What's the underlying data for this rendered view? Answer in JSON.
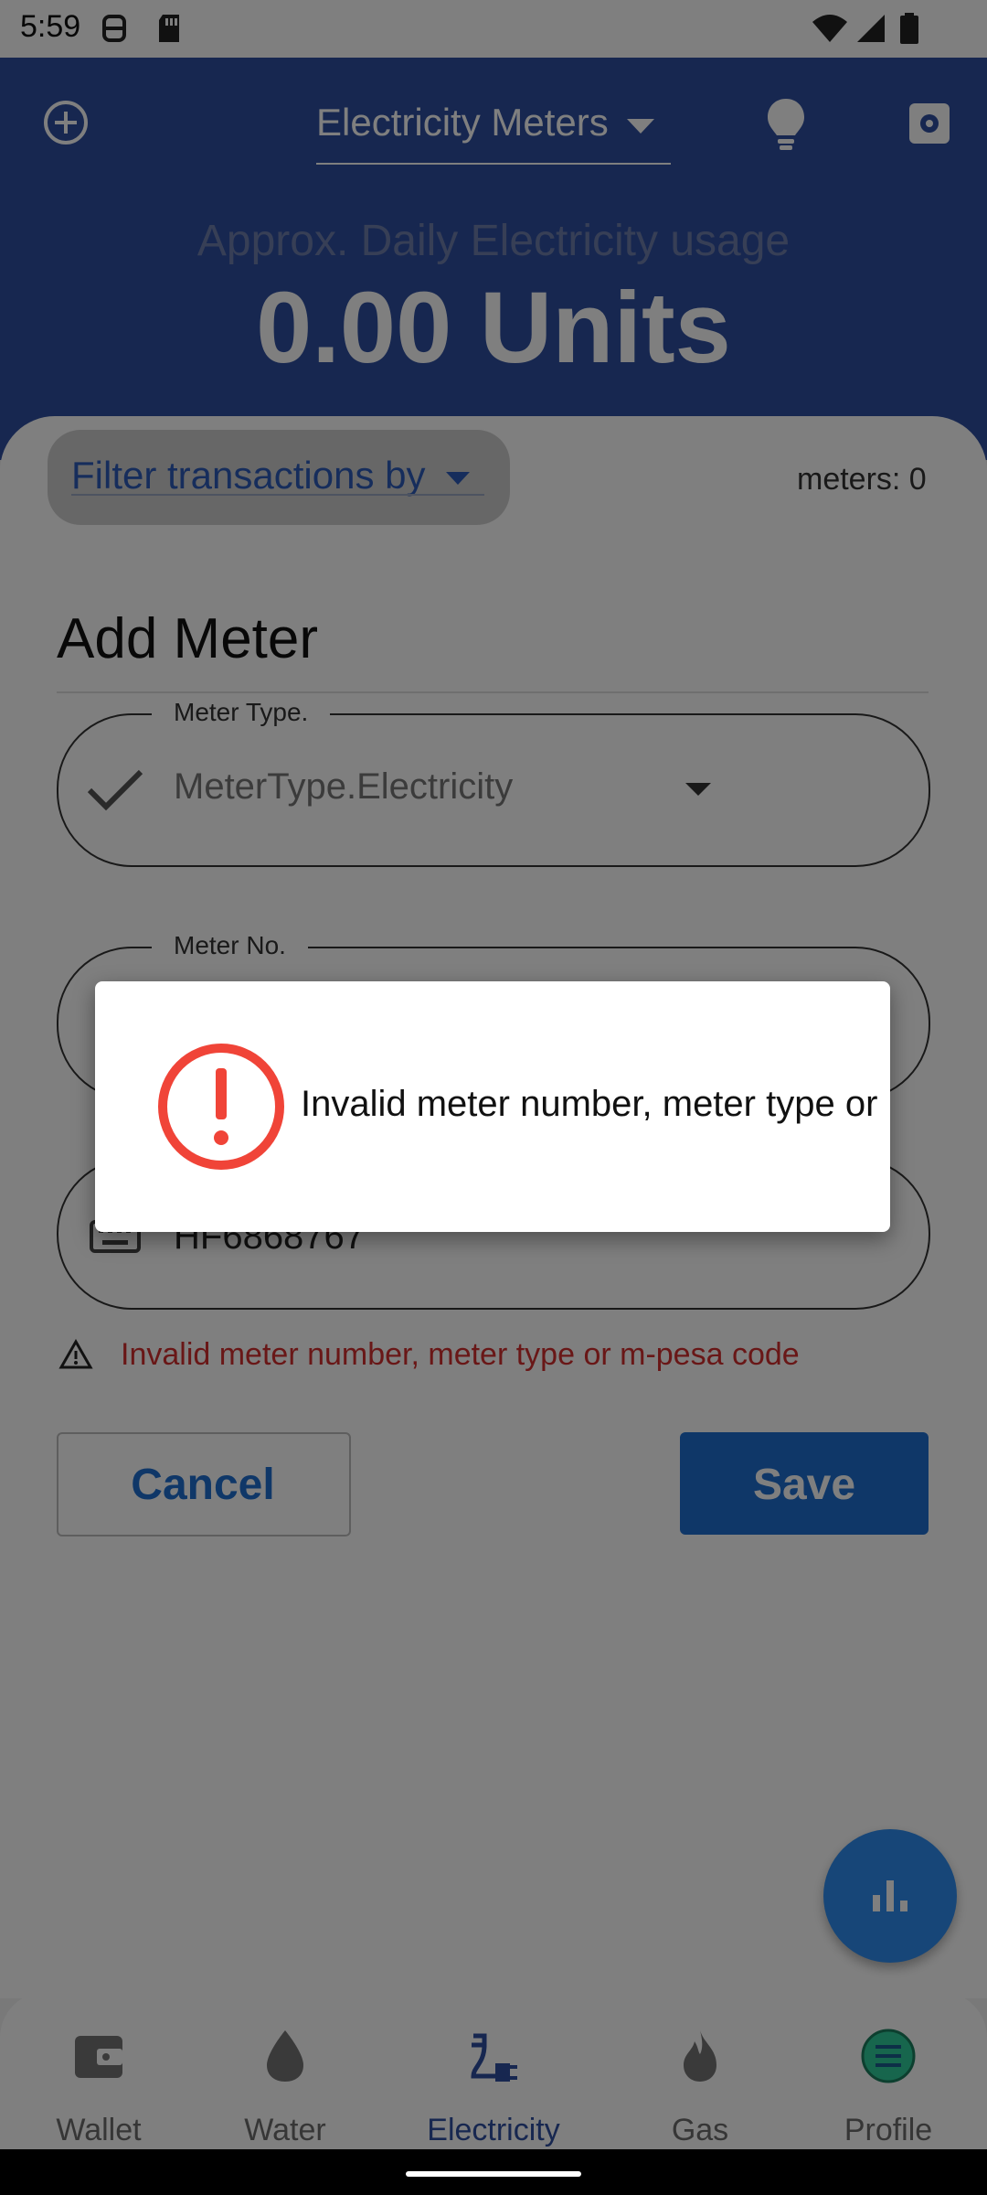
{
  "status_bar": {
    "time": "5:59"
  },
  "header": {
    "selector_label": "Electricity Meters",
    "usage_label": "Approx. Daily Electricity usage",
    "usage_value": "0.00 Units"
  },
  "filters": {
    "label": "Filter transactions by",
    "meters_count": "meters: 0"
  },
  "form": {
    "title": "Add Meter",
    "meter_type": {
      "label": "Meter Type.",
      "value": "MeterType.Electricity"
    },
    "meter_no": {
      "label": "Meter No.",
      "value": ""
    },
    "mpesa_code": {
      "value": "HF6868767"
    },
    "error_message": "Invalid meter number, meter type or m-pesa code",
    "cancel_label": "Cancel",
    "save_label": "Save"
  },
  "dialog": {
    "message": "Invalid meter number, meter type or m-pesa code"
  },
  "bottom_nav": {
    "items": [
      {
        "label": "Wallet"
      },
      {
        "label": "Water"
      },
      {
        "label": "Electricity"
      },
      {
        "label": "Gas"
      },
      {
        "label": "Profile"
      }
    ],
    "active": "Electricity"
  },
  "colors": {
    "primary": "#2f4fa1",
    "accent": "#1e6fd0",
    "error": "#d32f2f",
    "fab": "#2f8df0"
  }
}
